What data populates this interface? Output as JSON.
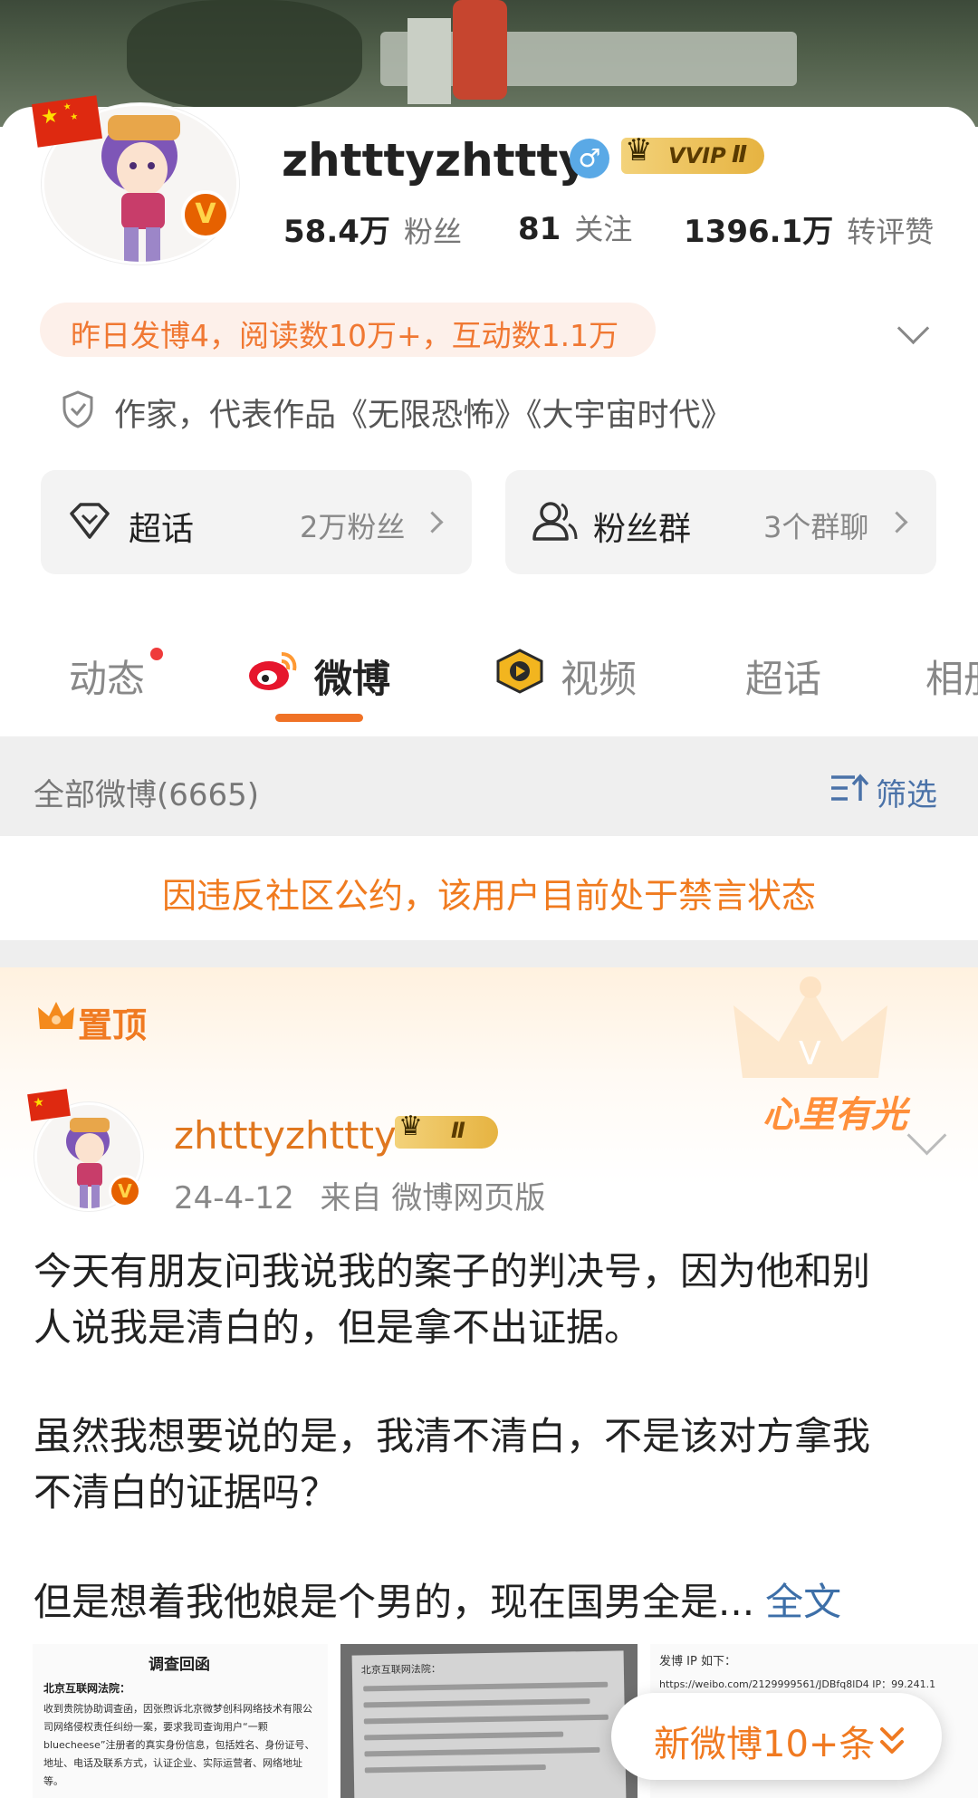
{
  "profile": {
    "username": "zhtttyzhttty",
    "vvip_label": "VVIP",
    "vvip_level": "Ⅱ",
    "stats": [
      {
        "value": "58.4万",
        "label": "粉丝"
      },
      {
        "value": "81",
        "label": "关注"
      },
      {
        "value": "1396.1万",
        "label": "转评赞"
      }
    ],
    "summary": "昨日发博4，阅读数10万+，互动数1.1万",
    "bio": "作家，代表作品《无限恐怖》《大宇宙时代》"
  },
  "cards": [
    {
      "title": "超话",
      "meta": "2万粉丝",
      "icon": "diamond-icon"
    },
    {
      "title": "粉丝群",
      "meta": "3个群聊",
      "icon": "people-icon"
    }
  ],
  "tabs": [
    {
      "label": "动态"
    },
    {
      "label": "微博"
    },
    {
      "label": "视频"
    },
    {
      "label": "超话"
    },
    {
      "label": "相册"
    }
  ],
  "filter": {
    "all_posts": "全部微博(6665)",
    "filter_label": "筛选"
  },
  "ban_notice": "因违反社区公约，该用户目前处于禁言状态",
  "pinned": {
    "label": "置顶",
    "decor_text": "心里有光",
    "post": {
      "username": "zhtttyzhttty",
      "level": "Ⅱ",
      "date": "24-4-12",
      "source": "来自 微博网页版",
      "lines": [
        "今天有朋友问我说我的案子的判决号，因为他和别",
        "人说我是清白的，但是拿不出证据。",
        "虽然我想要说的是，我清不清白，不是该对方拿我",
        "不清白的证据吗？",
        "但是想着我他娘是个男的，现在国男全是..."
      ],
      "fulltext_link": "全文"
    },
    "images": {
      "doc1_title": "调查回函",
      "doc1_line1": "北京互联网法院：",
      "doc1_body": "收到贵院协助调查函，因张煦诉北京微梦创科网络技术有限公司网络侵权责任纠纷一案，要求我司查询用户“一颗 bluecheese”注册者的真实身份信息，包括姓名、身份证号、地址、电话及联系方式，认证企业、实际运营者、网络地址等。",
      "doc2_title": "北京互联网法院：",
      "doc3_title": "发博 IP 如下：",
      "doc3_url": "https://weibo.com/2129999561/JDBfq8lD4 IP：99.241.1"
    }
  },
  "new_posts_button": "新微博10+条"
}
